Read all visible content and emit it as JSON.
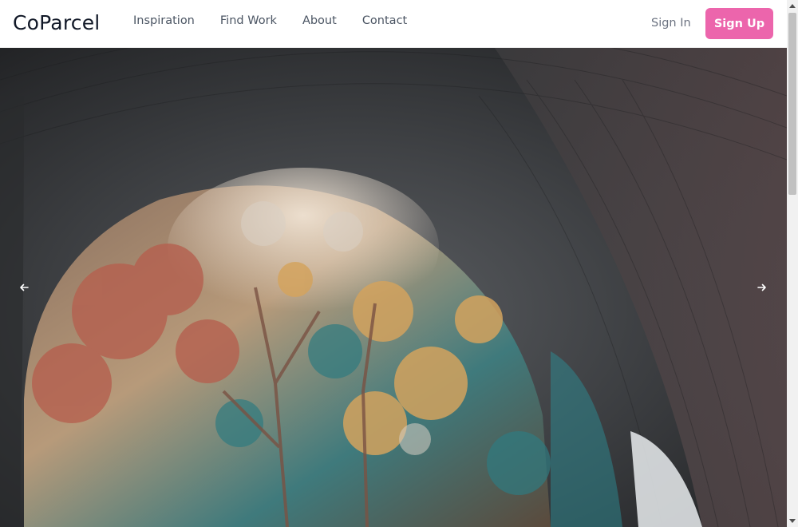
{
  "brand": {
    "name": "CoParcel"
  },
  "nav": {
    "links": [
      {
        "label": "Inspiration"
      },
      {
        "label": "Find Work"
      },
      {
        "label": "About"
      },
      {
        "label": "Contact"
      }
    ],
    "sign_in": "Sign In",
    "sign_up": "Sign Up"
  },
  "hero": {
    "prev_icon": "arrow-left-icon",
    "next_icon": "arrow-right-icon"
  },
  "colors": {
    "accent": "#ec65ac",
    "nav_text": "#4b5563",
    "brand_text": "#111827"
  }
}
